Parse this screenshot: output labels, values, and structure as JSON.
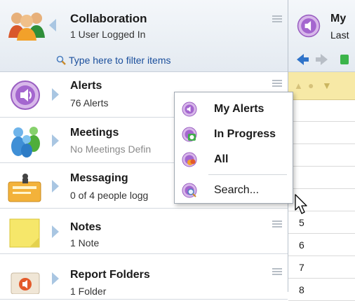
{
  "header": {
    "title": "Collaboration",
    "subtitle": "1 User Logged In",
    "filter_placeholder": "Type here to filter items"
  },
  "items": [
    {
      "title": "Alerts",
      "subtitle": "76 Alerts",
      "icon": "alerts-icon"
    },
    {
      "title": "Meetings",
      "subtitle": "No Meetings Defin",
      "icon": "meetings-icon"
    },
    {
      "title": "Messaging",
      "subtitle": "0 of 4 people logg",
      "icon": "messaging-icon"
    },
    {
      "title": "Notes",
      "subtitle": "1 Note",
      "icon": "notes-icon"
    },
    {
      "title": "Report Folders",
      "subtitle": "1 Folder",
      "icon": "report-folders-icon"
    }
  ],
  "context_menu": {
    "items": [
      {
        "label": "My Alerts",
        "icon": "my-alerts-icon"
      },
      {
        "label": "In Progress",
        "icon": "in-progress-icon"
      },
      {
        "label": "All",
        "icon": "all-alerts-icon"
      },
      {
        "label": "Search...",
        "icon": "search-alerts-icon"
      }
    ]
  },
  "right_panel": {
    "title": "My",
    "subtitle": "Last",
    "row_numbers": [
      "5",
      "6",
      "7",
      "8"
    ]
  },
  "colors": {
    "header_bg": "#e4eaf1",
    "link": "#1a4e9c",
    "toolbar_yellow": "#f7e9a6",
    "accent_purple": "#9a5fc2"
  }
}
